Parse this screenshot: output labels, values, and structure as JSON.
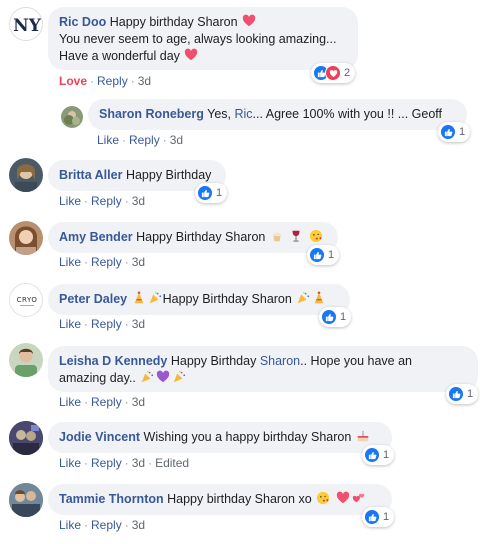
{
  "comments": [
    {
      "author": "Ric Doo",
      "text_line1": "Happy birthday Sharon",
      "text_line2": "You never seem to age, always looking amazing...",
      "text_line3": "Have a wonderful day",
      "actions": {
        "react": "Love",
        "reply": "Reply",
        "time": "3d"
      },
      "reaction_count": "2",
      "avatar_text": "NY"
    },
    {
      "author": "Sharon Roneberg",
      "text_pre": "Yes,",
      "mention": "Ric",
      "text_post": "... Agree 100% with you !! ... Geoff",
      "actions": {
        "react": "Like",
        "reply": "Reply",
        "time": "3d"
      },
      "reaction_count": "1"
    },
    {
      "author": "Britta Aller",
      "text": "Happy Birthday",
      "actions": {
        "react": "Like",
        "reply": "Reply",
        "time": "3d"
      },
      "reaction_count": "1"
    },
    {
      "author": "Amy Bender",
      "text": "Happy Birthday Sharon",
      "actions": {
        "react": "Like",
        "reply": "Reply",
        "time": "3d"
      },
      "reaction_count": "1"
    },
    {
      "author": "Peter Daley",
      "text": "Happy Birthday Sharon",
      "actions": {
        "react": "Like",
        "reply": "Reply",
        "time": "3d"
      },
      "reaction_count": "1",
      "avatar_text": "CRYO"
    },
    {
      "author": "Leisha D Kennedy",
      "text_pre": "Happy Birthday",
      "mention": "Sharon",
      "text_post": ".. Hope you have an",
      "text_line2": "amazing day..",
      "actions": {
        "react": "Like",
        "reply": "Reply",
        "time": "3d"
      },
      "reaction_count": "1"
    },
    {
      "author": "Jodie Vincent",
      "text": "Wishing you a happy birthday Sharon",
      "actions": {
        "react": "Like",
        "reply": "Reply",
        "time": "3d",
        "edited": "Edited"
      },
      "reaction_count": "1"
    },
    {
      "author": "Tammie Thornton",
      "text": "Happy birthday Sharon xo",
      "actions": {
        "react": "Like",
        "reply": "Reply",
        "time": "3d"
      },
      "reaction_count": "1"
    }
  ],
  "colors": {
    "author": "#385898",
    "bubble": "#f0f2f5",
    "like": "#1877f2",
    "love": "#f33e58",
    "meta": "#606770"
  }
}
